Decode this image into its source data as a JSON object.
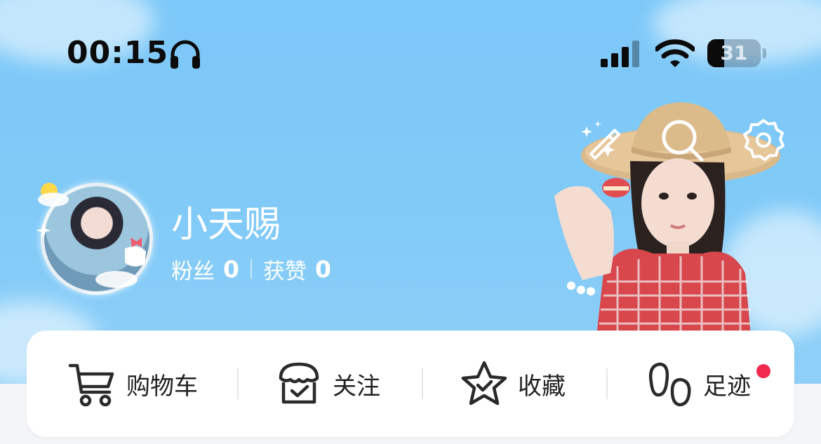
{
  "status_bar": {
    "time": "00:15",
    "battery": "31",
    "battery_level": 0.31,
    "icons": [
      "headphones-icon",
      "cellular-signal-icon",
      "wifi-icon",
      "battery-icon"
    ]
  },
  "header": {
    "icons": [
      "magic-wand-icon",
      "search-icon",
      "settings-icon"
    ]
  },
  "profile": {
    "username": "小天赐",
    "followers_label": "粉丝",
    "followers_count": "0",
    "likes_label": "获赞",
    "likes_count": "0"
  },
  "quick_actions": [
    {
      "label": "购物车",
      "icon": "shopping-cart-icon"
    },
    {
      "label": "关注",
      "icon": "store-follow-icon"
    },
    {
      "label": "收藏",
      "icon": "star-favorite-icon"
    },
    {
      "label": "足迹",
      "icon": "footprint-icon",
      "badge": true
    }
  ],
  "colors": {
    "header_bg": "#7cc8f8",
    "text_primary": "#222222",
    "badge": "#f2294e",
    "card_bg": "#ffffff"
  }
}
